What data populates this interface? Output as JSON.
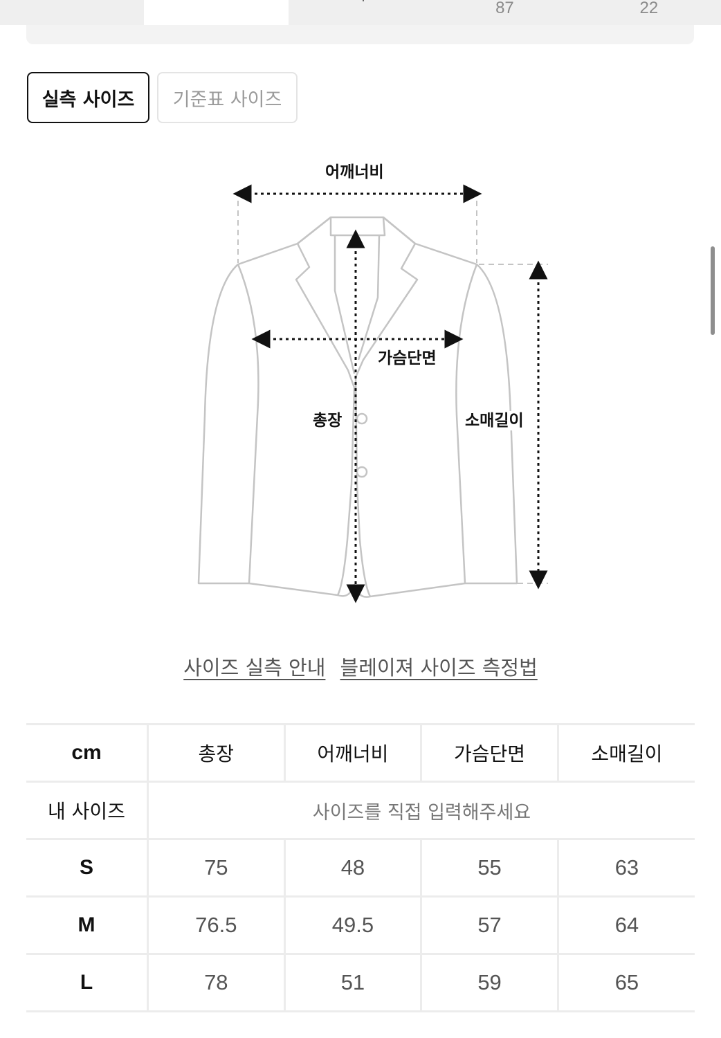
{
  "top": {
    "cells": [
      "",
      "",
      "",
      "87",
      "22"
    ]
  },
  "tabs": {
    "actual": "실측 사이즈",
    "standard": "기준표 사이즈"
  },
  "diagram": {
    "shoulder": "어깨너비",
    "chest": "가슴단면",
    "length": "총장",
    "sleeve": "소매길이"
  },
  "links": {
    "guide": "사이즈 실측 안내",
    "method": "블레이져 사이즈 측정법"
  },
  "table": {
    "unit": "cm",
    "columns": [
      "총장",
      "어깨너비",
      "가슴단면",
      "소매길이"
    ],
    "my_size_label": "내 사이즈",
    "my_size_hint": "사이즈를 직접 입력해주세요",
    "rows": [
      {
        "size": "S",
        "values": [
          "75",
          "48",
          "55",
          "63"
        ]
      },
      {
        "size": "M",
        "values": [
          "76.5",
          "49.5",
          "57",
          "64"
        ]
      },
      {
        "size": "L",
        "values": [
          "78",
          "51",
          "59",
          "65"
        ]
      }
    ]
  }
}
